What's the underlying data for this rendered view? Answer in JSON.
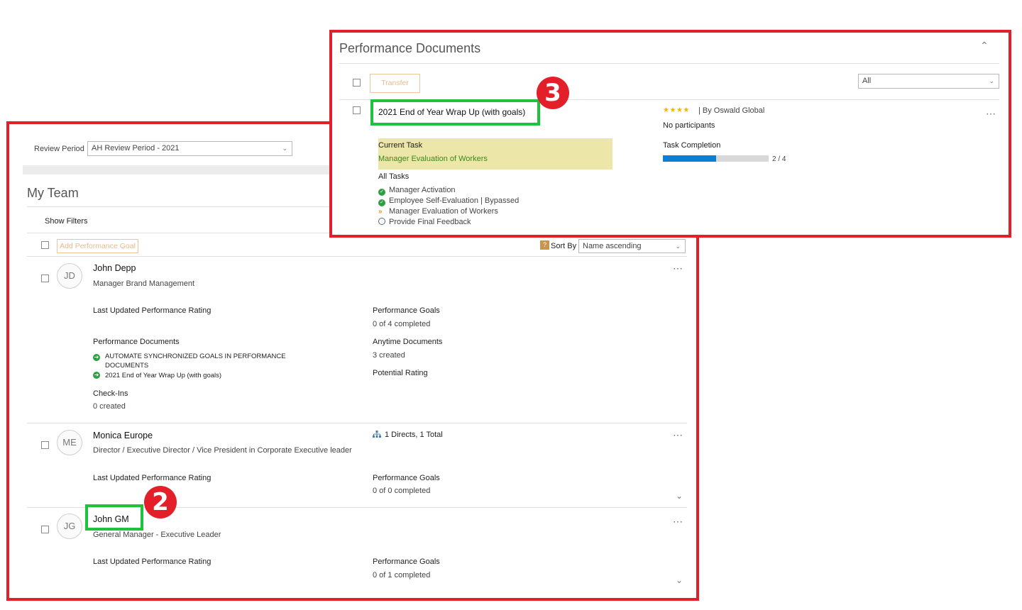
{
  "review_period": {
    "label": "Review Period",
    "value": "AH Review Period - 2021"
  },
  "my_team": {
    "title": "My Team",
    "show_filters": "Show Filters",
    "add_goal": "Add Performance Goal",
    "help": "?",
    "sort_label": "Sort By",
    "sort_value": "Name ascending",
    "members": [
      {
        "initials": "JD",
        "name": "John Depp",
        "title": "Manager Brand Management",
        "last_rating_label": "Last Updated Performance Rating",
        "goals_label": "Performance Goals",
        "goals_value": "0 of 4 completed",
        "docs_label": "Performance Documents",
        "docs": [
          "AUTOMATE SYNCHRONIZED GOALS IN PERFORMANCE DOCUMENTS",
          "2021 End of Year Wrap Up (with goals)"
        ],
        "anytime_label": "Anytime Documents",
        "anytime_value": "3 created",
        "potential_label": "Potential Rating",
        "checkins_label": "Check-Ins",
        "checkins_value": "0 created"
      },
      {
        "initials": "ME",
        "name": "Monica Europe",
        "title": "Director / Executive Director / Vice President in Corporate Executive leader",
        "directs": "1 Directs, 1 Total",
        "last_rating_label": "Last Updated Performance Rating",
        "goals_label": "Performance Goals",
        "goals_value": "0 of 0 completed"
      },
      {
        "initials": "JG",
        "name": "John GM",
        "title": "General Manager - Executive Leader",
        "last_rating_label": "Last Updated Performance Rating",
        "goals_label": "Performance Goals",
        "goals_value": "0 of 1 completed"
      }
    ]
  },
  "perf_docs": {
    "title": "Performance Documents",
    "transfer": "Transfer",
    "filter_value": "All",
    "document": {
      "name": "2021 End of Year Wrap Up (with goals)",
      "rating_stars": 4,
      "by": "| By Oswald Global",
      "participants": "No participants",
      "current_task_label": "Current Task",
      "current_task_value": "Manager Evaluation of Workers",
      "all_tasks_label": "All Tasks",
      "tasks": [
        {
          "label": "Manager Activation",
          "status": "done"
        },
        {
          "label": "Employee Self-Evaluation | Bypassed",
          "status": "done"
        },
        {
          "label": "Manager Evaluation of Workers",
          "status": "current"
        },
        {
          "label": "Provide Final Feedback",
          "status": "pending"
        }
      ],
      "completion_label": "Task Completion",
      "completion_text": "2 / 4",
      "completion_fraction": 0.5
    }
  },
  "badges": {
    "step2": "2",
    "step3": "3"
  },
  "colors": {
    "highlight_red": "#e3202a",
    "highlight_green": "#1fc23c",
    "progress": "#0a7fd4",
    "task_bg": "#ece6a8"
  }
}
